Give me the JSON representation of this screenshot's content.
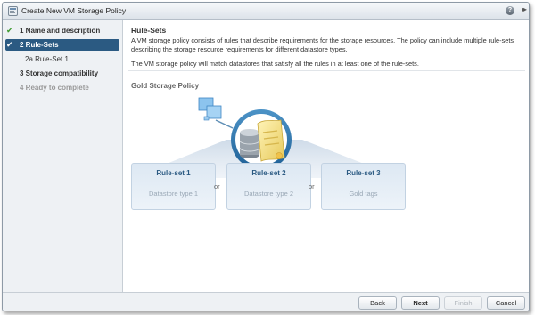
{
  "window": {
    "title": "Create New VM Storage Policy",
    "help": "?"
  },
  "sidebar": {
    "steps": [
      {
        "label": "1  Name and description",
        "done": true
      },
      {
        "label": "2  Rule-Sets",
        "done": true
      },
      {
        "label": "2a  Rule-Set 1",
        "done": false
      },
      {
        "label": "3  Storage compatibility",
        "done": false
      },
      {
        "label": "4  Ready to complete",
        "done": false
      }
    ]
  },
  "main": {
    "heading": "Rule-Sets",
    "description": "A VM storage policy consists of rules that describe requirements for the storage resources. The policy can include multiple rule-sets describing the storage resource requirements for different datastore types.",
    "description2": "The VM storage policy will match datastores that satisfy all the rules in at least one of the rule-sets.",
    "policy_title": "Gold Storage Policy",
    "rulesets": [
      {
        "title": "Rule-set 1",
        "subtitle": "Datastore type 1"
      },
      {
        "title": "Rule-set 2",
        "subtitle": "Datastore type 2"
      },
      {
        "title": "Rule-set 3",
        "subtitle": "Gold tags"
      }
    ],
    "or_label": "or"
  },
  "footer": {
    "back": "Back",
    "next": "Next",
    "finish": "Finish",
    "cancel": "Cancel"
  },
  "colors": {
    "accent": "#2b5a82",
    "check": "#3d9a2e",
    "panel": "#eef1f4"
  },
  "icons": [
    "wizard-icon",
    "help-icon",
    "expand-icon",
    "check-icon",
    "datastore-icon",
    "scroll-icon",
    "vm-icon"
  ]
}
